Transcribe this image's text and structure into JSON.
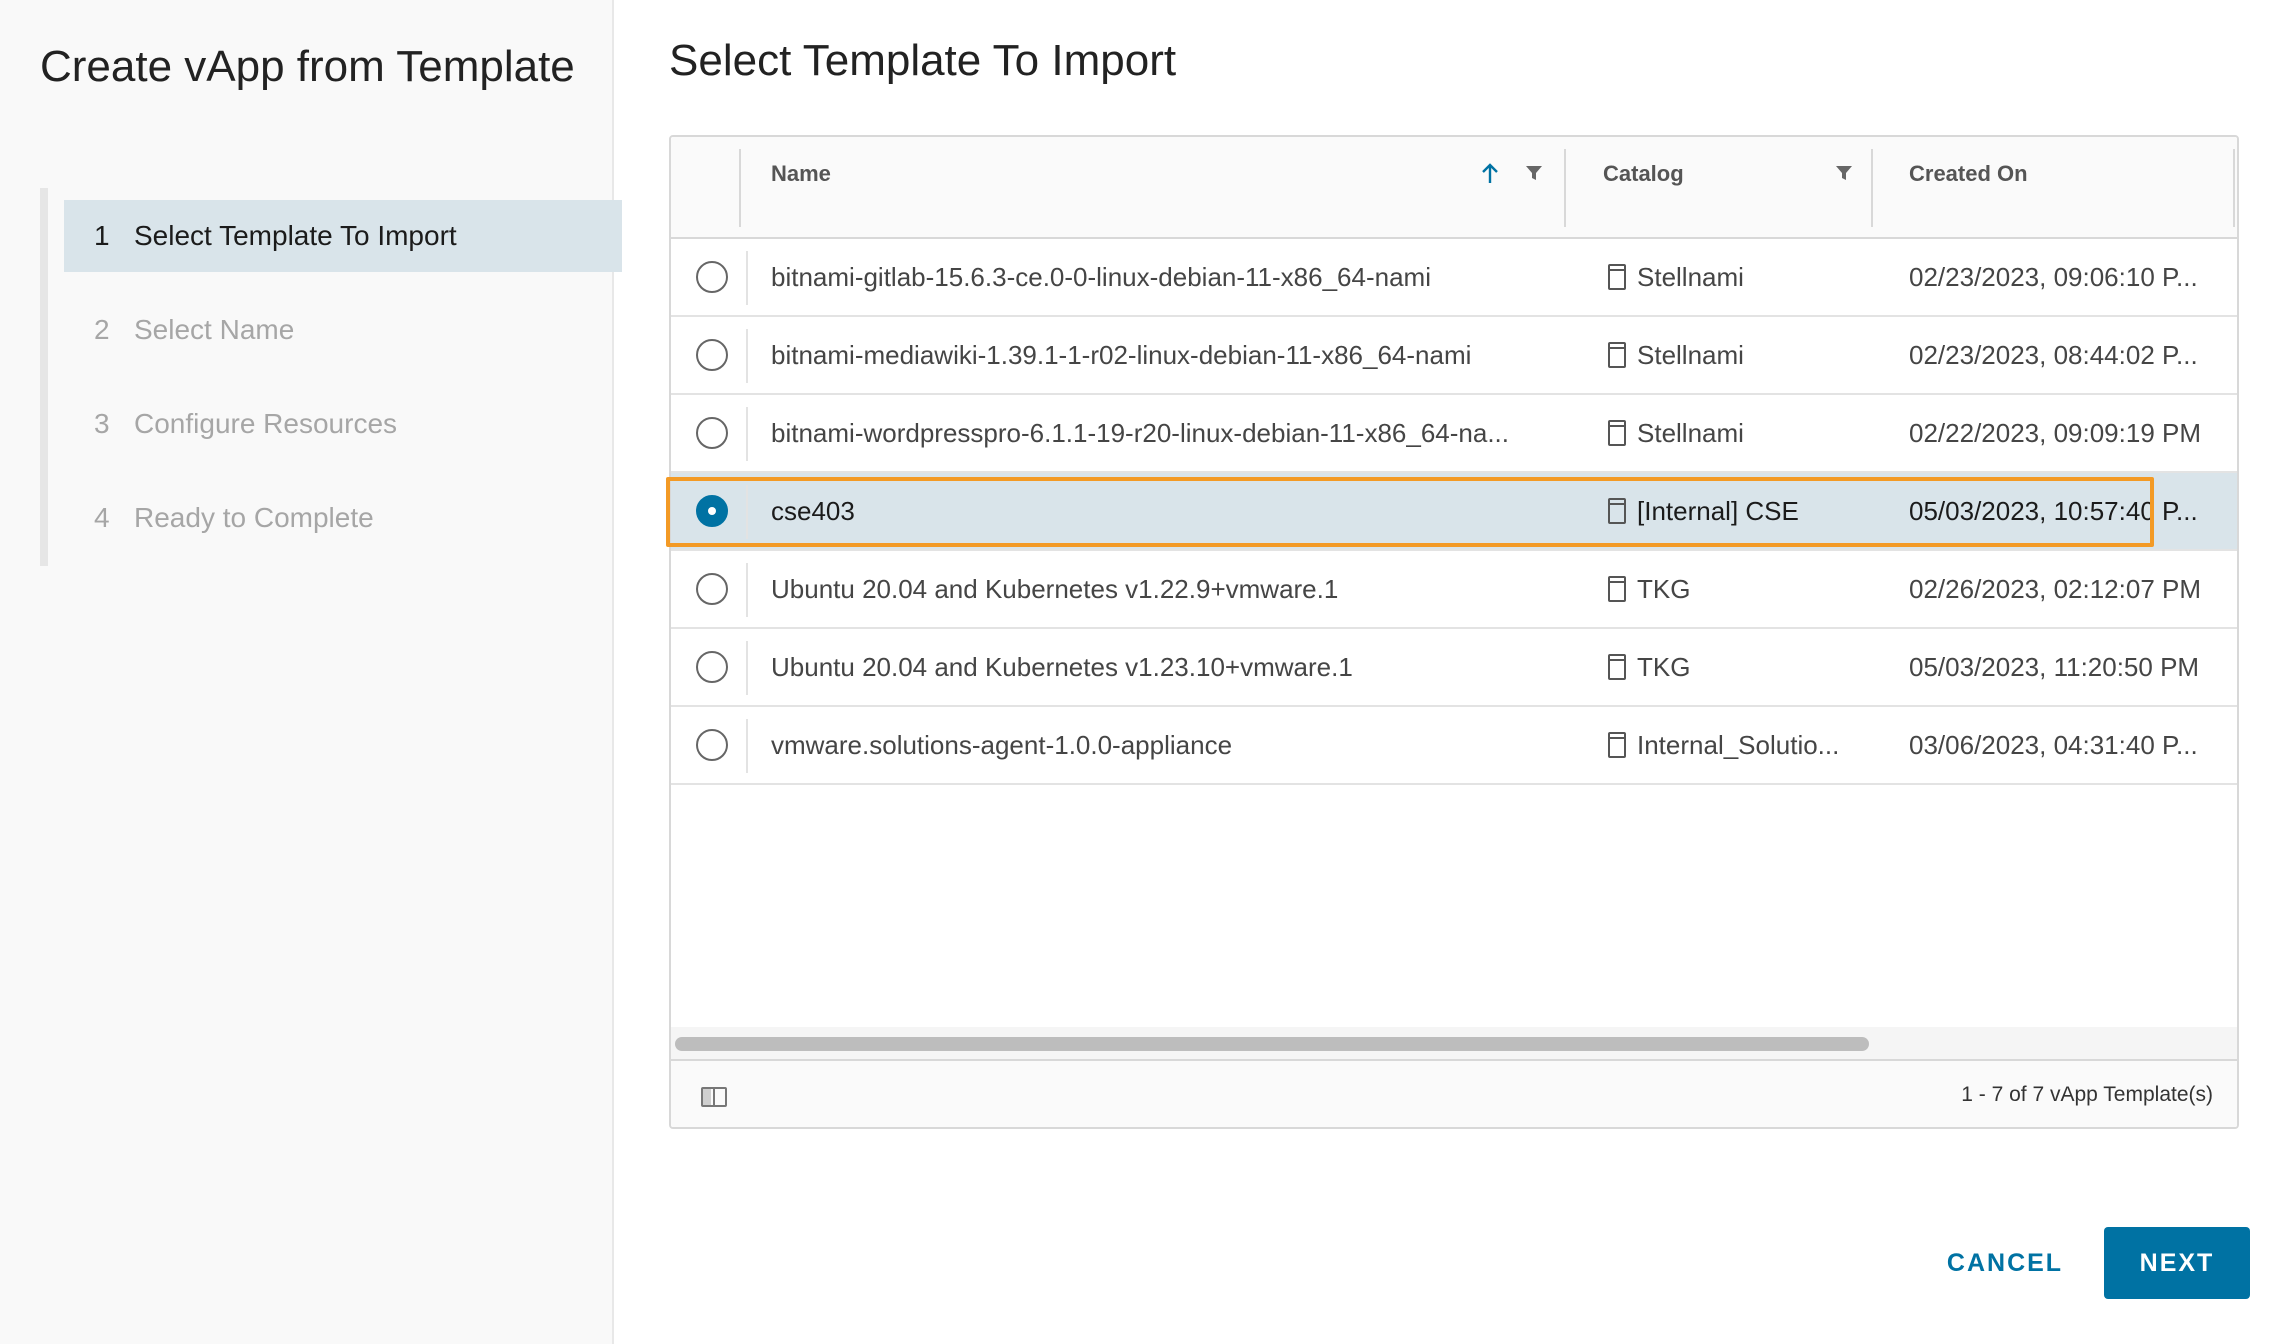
{
  "wizard": {
    "title": "Create vApp from Template",
    "steps": [
      {
        "num": "1",
        "label": "Select Template To Import",
        "active": true
      },
      {
        "num": "2",
        "label": "Select Name",
        "active": false
      },
      {
        "num": "3",
        "label": "Configure Resources",
        "active": false
      },
      {
        "num": "4",
        "label": "Ready to Complete",
        "active": false
      }
    ]
  },
  "main": {
    "title": "Select Template To Import"
  },
  "grid": {
    "columns": {
      "name": "Name",
      "catalog": "Catalog",
      "created": "Created On"
    },
    "sort_icon": "arrow-up-icon",
    "filter_icon": "filter-icon",
    "rows": [
      {
        "name": "bitnami-gitlab-15.6.3-ce.0-0-linux-debian-11-x86_64-nami",
        "catalog": "Stellnami",
        "created": "02/23/2023, 09:06:10 P...",
        "selected": false
      },
      {
        "name": "bitnami-mediawiki-1.39.1-1-r02-linux-debian-11-x86_64-nami",
        "catalog": "Stellnami",
        "created": "02/23/2023, 08:44:02 P...",
        "selected": false
      },
      {
        "name": "bitnami-wordpresspro-6.1.1-19-r20-linux-debian-11-x86_64-na...",
        "catalog": "Stellnami",
        "created": "02/22/2023, 09:09:19 PM",
        "selected": false
      },
      {
        "name": "cse403",
        "catalog": "[Internal] CSE",
        "created": "05/03/2023, 10:57:40 P...",
        "selected": true
      },
      {
        "name": "Ubuntu 20.04 and Kubernetes v1.22.9+vmware.1",
        "catalog": "TKG",
        "created": "02/26/2023, 02:12:07 PM",
        "selected": false
      },
      {
        "name": "Ubuntu 20.04 and Kubernetes v1.23.10+vmware.1",
        "catalog": "TKG",
        "created": "05/03/2023, 11:20:50 PM",
        "selected": false
      },
      {
        "name": "vmware.solutions-agent-1.0.0-appliance",
        "catalog": "Internal_Solutio...",
        "created": "03/06/2023, 04:31:40 P...",
        "selected": false
      }
    ],
    "footer": {
      "pager": "1 - 7 of 7 vApp Template(s)",
      "column_toggle_icon": "column-toggle-icon"
    }
  },
  "buttons": {
    "cancel": "CANCEL",
    "next": "NEXT"
  },
  "colors": {
    "accent": "#0072a3",
    "highlight": "#f39a25",
    "selected_row": "#d9e4ea"
  }
}
